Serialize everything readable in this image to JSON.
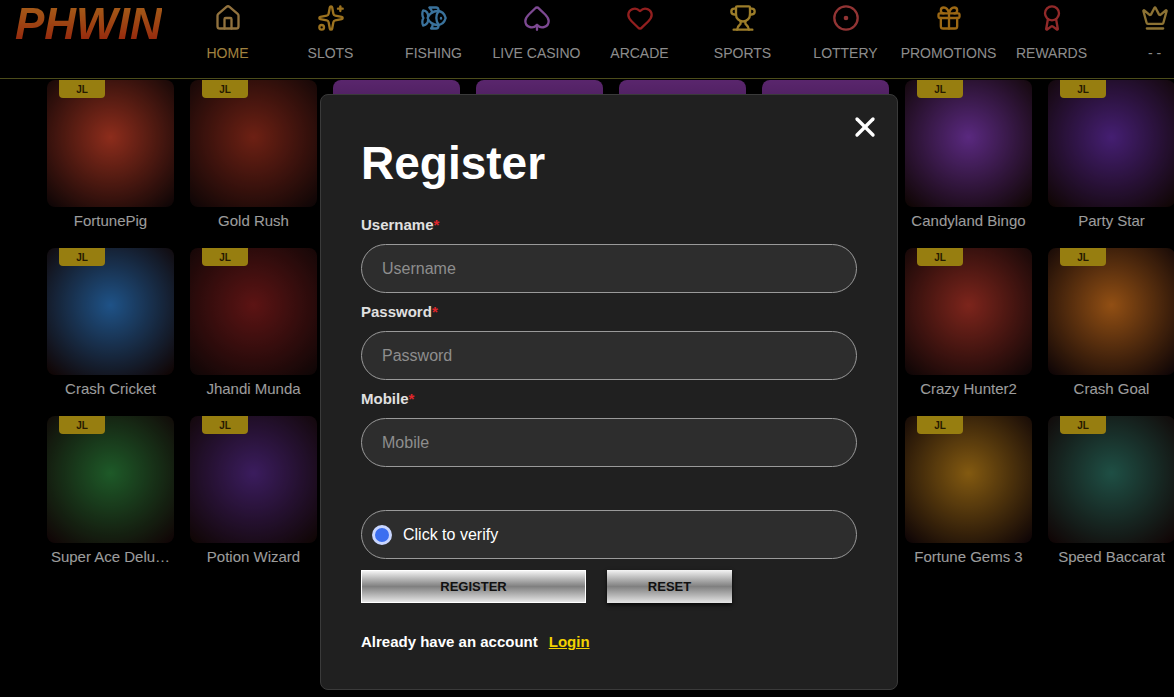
{
  "logo": {
    "text": "PHWIN"
  },
  "nav": [
    {
      "label": "HOME",
      "selected": true
    },
    {
      "label": "SLOTS",
      "selected": false
    },
    {
      "label": "FISHING",
      "selected": false
    },
    {
      "label": "LIVE CASINO",
      "selected": false
    },
    {
      "label": "ARCADE",
      "selected": false
    },
    {
      "label": "SPORTS",
      "selected": false
    },
    {
      "label": "LOTTERY",
      "selected": false
    },
    {
      "label": "PROMOTIONS",
      "selected": false
    },
    {
      "label": "REWARDS",
      "selected": false
    },
    {
      "label": "- -",
      "selected": false
    }
  ],
  "provider_badge": "JL",
  "game_rows": [
    {
      "left": [
        {
          "title": "FortunePig",
          "color": "#d9452b"
        },
        {
          "title": "Gold Rush",
          "color": "#a8321f"
        }
      ],
      "right": [
        {
          "title": "Candyland Bingo",
          "color": "#8a3fc4"
        },
        {
          "title": "Party Star",
          "color": "#6a2fb0"
        }
      ]
    },
    {
      "left": [
        {
          "title": "Crash Cricket",
          "color": "#2f7fd0"
        },
        {
          "title": "Jhandi Munda",
          "color": "#8e1f1f"
        }
      ],
      "right": [
        {
          "title": "Crazy Hunter2",
          "color": "#c0392b"
        },
        {
          "title": "Crash Goal",
          "color": "#e07a1f"
        }
      ]
    },
    {
      "left": [
        {
          "title": "Super Ace Delu…",
          "color": "#2e8a3e"
        },
        {
          "title": "Potion Wizard",
          "color": "#5b2c91"
        }
      ],
      "right": [
        {
          "title": "Fortune Gems 3",
          "color": "#c98a1a"
        },
        {
          "title": "Speed Baccarat",
          "color": "#2f7a6a"
        }
      ]
    }
  ],
  "modal": {
    "title": "Register",
    "required_mark": "*",
    "fields": [
      {
        "label": "Username",
        "placeholder": "Username"
      },
      {
        "label": "Password",
        "placeholder": "Password"
      },
      {
        "label": "Mobile",
        "placeholder": "Mobile"
      }
    ],
    "verify": {
      "label": "Click to verify"
    },
    "buttons": [
      "REGISTER",
      "RESET"
    ],
    "footer": {
      "text": "Already have an account",
      "link": "Login"
    }
  }
}
